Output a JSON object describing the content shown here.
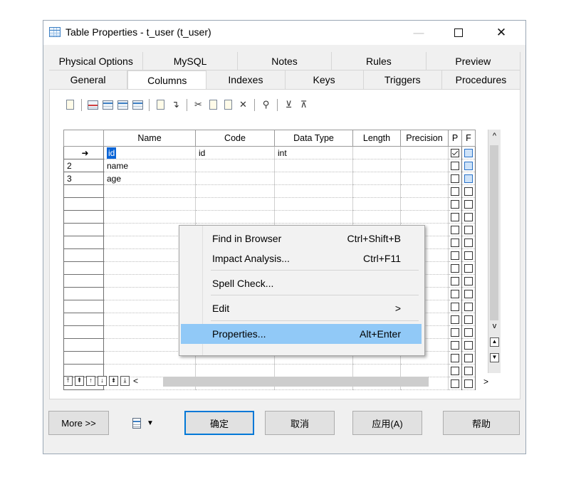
{
  "window": {
    "title": "Table Properties - t_user (t_user)",
    "controls": {
      "minimize": "—",
      "maximize": "",
      "close": "✕"
    }
  },
  "tabs": {
    "row1": [
      "Physical Options",
      "MySQL",
      "Notes",
      "Rules",
      "Preview"
    ],
    "row2": [
      "General",
      "Columns",
      "Indexes",
      "Keys",
      "Triggers",
      "Procedures"
    ],
    "active": "Columns"
  },
  "grid": {
    "headers": [
      "Name",
      "Code",
      "Data Type",
      "Length",
      "Precision",
      "P",
      "F"
    ],
    "rows": [
      {
        "num": "➜",
        "name": "id",
        "code": "id",
        "type": "int",
        "p": true,
        "f": true
      },
      {
        "num": "2",
        "name": "name",
        "code": "",
        "type": "",
        "p": false,
        "f": true
      },
      {
        "num": "3",
        "name": "age",
        "code": "",
        "type": "",
        "p": false,
        "f": true
      }
    ],
    "empty_rows": 16,
    "nav": [
      "⤒",
      "⇞",
      "↑",
      "↓",
      "⇟",
      "⤓"
    ]
  },
  "context_menu": {
    "items": [
      {
        "label": "Find in Browser",
        "shortcut": "Ctrl+Shift+B"
      },
      {
        "label": "Impact Analysis...",
        "shortcut": "Ctrl+F11"
      },
      {
        "label": "Spell Check...",
        "shortcut": ""
      },
      {
        "label": "Edit",
        "shortcut": ">"
      },
      {
        "label": "Properties...",
        "shortcut": "Alt+Enter"
      }
    ]
  },
  "buttons": {
    "more": "More >>",
    "ok": "确定",
    "cancel": "取消",
    "apply": "应用(A)",
    "help": "帮助"
  },
  "colors": {
    "menu_highlight": "#91c9f7",
    "selection": "#0a64d6",
    "default_button": "#0078d7"
  }
}
